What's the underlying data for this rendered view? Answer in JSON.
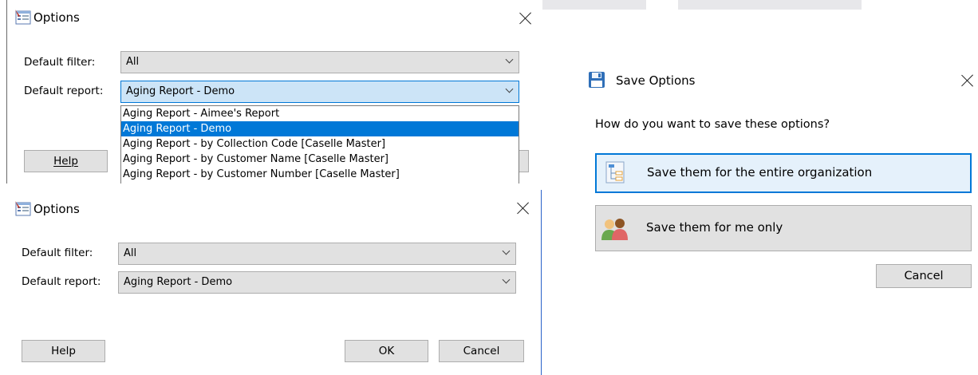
{
  "options_dropdown": {
    "title": "Options",
    "default_filter_label": "Default filter:",
    "default_filter_value": "All",
    "default_report_label": "Default report:",
    "default_report_value": "Aging Report - Demo",
    "dropdown_items": [
      "Aging Report - Aimee's Report",
      "Aging Report - Demo",
      "Aging Report - by Collection Code [Caselle Master]",
      "Aging Report - by Customer Name [Caselle Master]",
      "Aging Report - by Customer Number [Caselle Master]"
    ],
    "selected_index": 1,
    "help_label": "Help"
  },
  "options_main": {
    "title": "Options",
    "default_filter_label": "Default filter:",
    "default_filter_value": "All",
    "default_report_label": "Default report:",
    "default_report_value": "Aging Report - Demo",
    "help_label": "Help",
    "ok_label": "OK",
    "cancel_label": "Cancel"
  },
  "save_options": {
    "title": "Save Options",
    "prompt": "How do you want to save these options?",
    "org_label": "Save them for the entire organization",
    "me_label": "Save them for me only",
    "cancel_label": "Cancel"
  },
  "colors": {
    "accent": "#0078d7",
    "selected_bg": "#0078d7",
    "button_bg": "#e1e1e1",
    "active_combo_bg": "#cce4f7"
  },
  "icons": {
    "options": "options-dialog-icon",
    "save": "floppy-disk-icon",
    "organization": "organization-chart-icon",
    "users": "users-icon",
    "close": "close-icon",
    "dropdown": "chevron-down-icon"
  }
}
